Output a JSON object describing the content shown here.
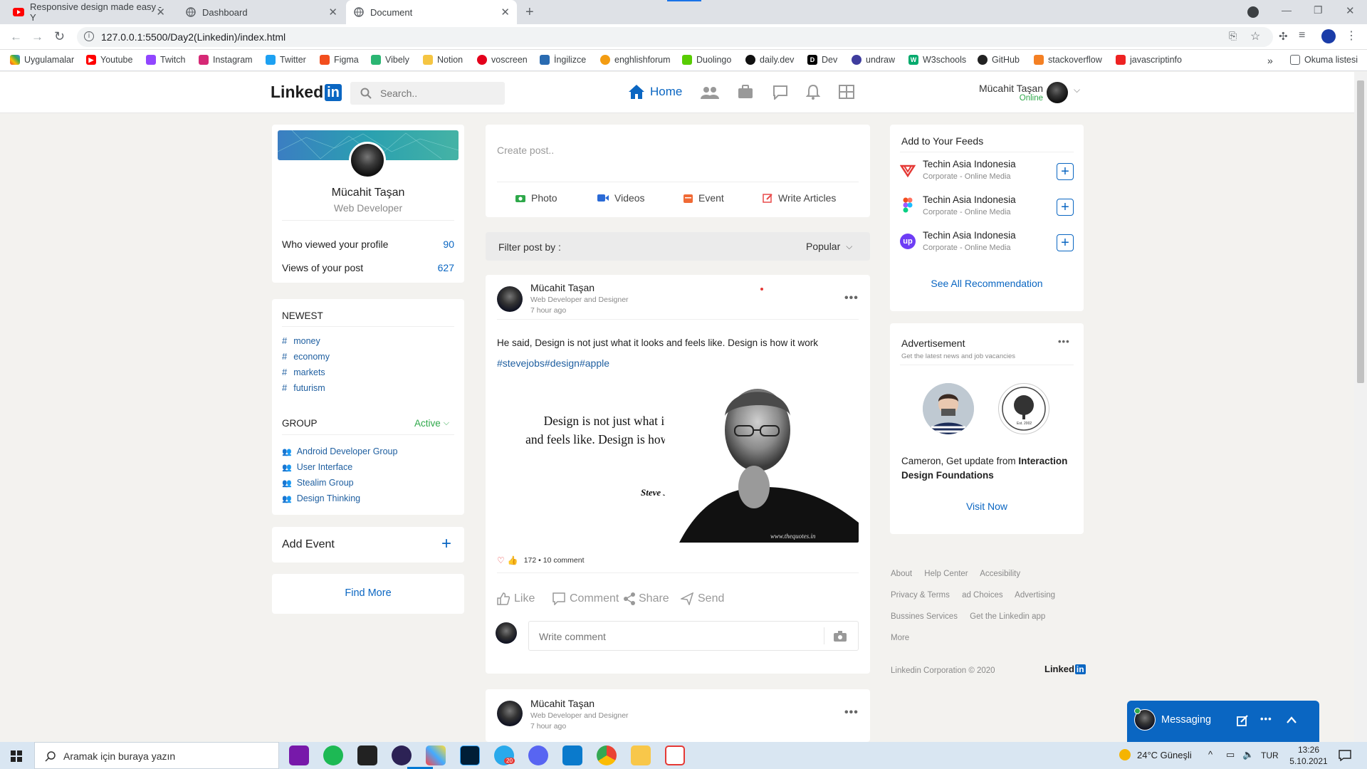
{
  "browser": {
    "tabs": [
      {
        "title": "Responsive design made easy - Y"
      },
      {
        "title": "Dashboard"
      },
      {
        "title": "Document"
      }
    ],
    "url": "127.0.0.1:5500/Day2(Linkedin)/index.html",
    "bookmarks": [
      "Uygulamalar",
      "Youtube",
      "Twitch",
      "Instagram",
      "Twitter",
      "Figma",
      "Vibely",
      "Notion",
      "voscreen",
      "İngilizce",
      "enghlishforum",
      "Duolingo",
      "daily.dev",
      "Dev",
      "undraw",
      "W3schools",
      "GitHub",
      "stackoverflow",
      "javascriptinfo"
    ],
    "reading_list": "Okuma listesi",
    "more_bookmarks": "»"
  },
  "header": {
    "logo_text": "Linked",
    "logo_in": "in",
    "search_placeholder": "Search..",
    "home_label": "Home",
    "user_name": "Mücahit Taşan",
    "user_status": "Online"
  },
  "profile": {
    "name": "Mücahit Taşan",
    "title": "Web Developer",
    "stats": [
      {
        "label": "Who viewed your profile",
        "value": "90"
      },
      {
        "label": "Views of your post",
        "value": "627"
      }
    ]
  },
  "newest": {
    "heading": "NEWEST",
    "tags": [
      "money",
      "economy",
      "markets",
      "futurism"
    ]
  },
  "group": {
    "heading": "GROUP",
    "filter": "Active",
    "items": [
      "Android Developer Group",
      "User Interface",
      "Stealim Group",
      "Design Thinking"
    ]
  },
  "add_event": "Add Event",
  "find_more": "Find More",
  "create_post": {
    "placeholder": "Create post..",
    "actions": [
      "Photo",
      "Videos",
      "Event",
      "Write Articles"
    ]
  },
  "filter": {
    "label": "Filter post by :",
    "value": "Popular"
  },
  "post": {
    "author": "Mücahit Taşan",
    "subtitle": "Web Developer and Designer",
    "time": "7 hour ago",
    "text": "He said, Design is not just what it looks and feels like. Design is how it work",
    "hashtags": "#stevejobs#design#apple",
    "quote_line1": "Design is not just what it looks",
    "quote_line2": "and feels like. Design is how it works.",
    "quote_author": "Steve Jobs",
    "watermark": "www.thequotes.in",
    "reactions": "172 • 10 comment",
    "actions": [
      "Like",
      "Comment",
      "Share",
      "Send"
    ],
    "comment_placeholder": "Write comment"
  },
  "post2": {
    "author": "Mücahit Taşan",
    "subtitle": "Web Developer and Designer",
    "time": "7 hour ago"
  },
  "feeds": {
    "heading": "Add to Your Feeds",
    "items": [
      {
        "name": "Techin Asia Indonesia",
        "sub": "Corporate - Online Media"
      },
      {
        "name": "Techin Asia Indonesia",
        "sub": "Corporate - Online Media"
      },
      {
        "name": "Techin Asia Indonesia",
        "sub": "Corporate - Online Media"
      }
    ],
    "see_all": "See All Recommendation"
  },
  "ad": {
    "heading": "Advertisement",
    "sub": "Get the latest news and job vacancies",
    "badge_text": "Est. 2002",
    "text_normal": "Cameron, Get update from ",
    "text_bold": "Interaction Design Foundations",
    "cta": "Visit Now"
  },
  "footer": {
    "links": [
      "About",
      "Help Center",
      "Accesibility",
      "Privacy & Terms",
      "ad Choices",
      "Advertising",
      "Bussines Services",
      "Get the Linkedin app",
      "More"
    ],
    "copyright": "Linkedin Corporation © 2020",
    "logo": "Linked",
    "logo_in": "in"
  },
  "messaging": {
    "label": "Messaging"
  },
  "taskbar": {
    "search_placeholder": "Aramak için buraya yazın",
    "weather": "24°C  Güneşli",
    "lang": "TUR",
    "time": "13:26",
    "date": "5.10.2021",
    "telegram_badge": "20"
  },
  "colors": {
    "accent": "#0a66c2",
    "online": "#2ea84a",
    "background": "#f3f2ef"
  }
}
